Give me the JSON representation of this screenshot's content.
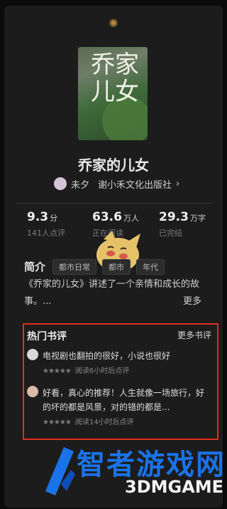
{
  "book": {
    "title": "乔家的儿女",
    "cover_text": "乔家\n儿女",
    "author": "未夕",
    "publisher": "谢小禾文化出版社",
    "publisher_chevron": "›"
  },
  "stats": [
    {
      "value": "9.3",
      "unit": "分",
      "sub": "141人点评"
    },
    {
      "value": "63.6",
      "unit": "万人",
      "sub": "正在阅读"
    },
    {
      "value": "29.3",
      "unit": "万字",
      "sub": "已完结"
    }
  ],
  "intro": {
    "label": "简介",
    "tags": [
      "都市日常",
      "都市",
      "年代"
    ],
    "description": "《乔家的儿女》讲述了一个亲情和成长的故事。...",
    "more": "更多"
  },
  "reviews": {
    "title": "热门书评",
    "more": "更多书评",
    "items": [
      {
        "text": "电视剧也翻拍的很好，小说也很好",
        "stars": "★★★★★",
        "meta": "阅读6小时后点评"
      },
      {
        "text": "好看，真心的推荐！人生就像一场旅行，好的坏的都是风景，对的错的都是...",
        "stars": "★★★★★",
        "meta": "阅读14小时后点评"
      }
    ]
  },
  "watermark": {
    "main": "智者游戏网",
    "sub": "3DMGAME"
  },
  "colors": {
    "highlight_box": "#e02d1d",
    "watermark_blue": "#1a73e8"
  }
}
